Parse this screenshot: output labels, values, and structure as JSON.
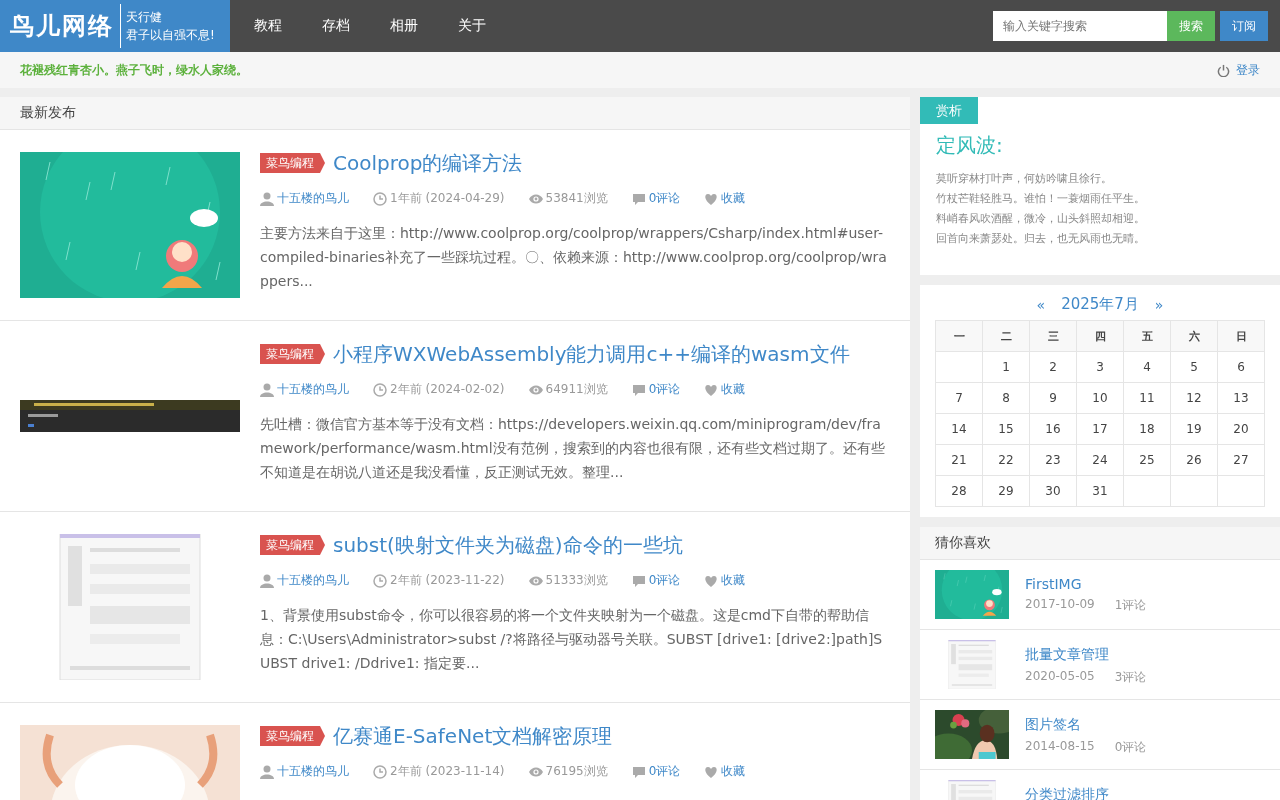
{
  "header": {
    "logo": "鸟儿网络",
    "tagline": [
      "天行健",
      "君子以自强不息!"
    ],
    "nav": [
      {
        "label": "教程"
      },
      {
        "label": "存档"
      },
      {
        "label": "相册"
      },
      {
        "label": "关于"
      }
    ],
    "search": {
      "placeholder": "输入关键字搜索",
      "button": "搜索"
    },
    "subscribe": "订阅"
  },
  "subheader": {
    "motto": "花褪残红青杏小。燕子飞时，绿水人家绕。",
    "login": "登录"
  },
  "latest": {
    "title": "最新发布",
    "articles": [
      {
        "category": "菜鸟编程",
        "title": "Coolprop的编译方法",
        "author": "十五楼的鸟儿",
        "time": "1年前 (2024-04-29)",
        "views": "53841浏览",
        "comments": "0评论",
        "favorite": "收藏",
        "excerpt": "主要方法来自于这里：http://www.coolprop.org/coolprop/wrappers/Csharp/index.html#user-compiled-binaries补充了一些踩坑过程。〇、依赖来源：http://www.coolprop.org/coolprop/wrappers..."
      },
      {
        "category": "菜鸟编程",
        "title": "小程序WXWebAssembly能力调用c++编译的wasm文件",
        "author": "十五楼的鸟儿",
        "time": "2年前 (2024-02-02)",
        "views": "64911浏览",
        "comments": "0评论",
        "favorite": "收藏",
        "excerpt": "先吐槽：微信官方基本等于没有文档：https://developers.weixin.qq.com/miniprogram/dev/framework/performance/wasm.html没有范例，搜索到的内容也很有限，还有些文档过期了。还有些不知道是在胡说八道还是我没看懂，反正测试无效。整理..."
      },
      {
        "category": "菜鸟编程",
        "title": "subst(映射文件夹为磁盘)命令的一些坑",
        "author": "十五楼的鸟儿",
        "time": "2年前 (2023-11-22)",
        "views": "51333浏览",
        "comments": "0评论",
        "favorite": "收藏",
        "excerpt": "1、背景使用subst命令，你可以很容易的将一个文件夹映射为一个磁盘。这是cmd下自带的帮助信息：C:\\Users\\Administrator>subst /?将路径与驱动器号关联。SUBST [drive1: [drive2:]path]SUBST drive1: /Ddrive1: 指定要..."
      },
      {
        "category": "菜鸟编程",
        "title": "亿赛通E-SafeNet文档解密原理",
        "author": "十五楼的鸟儿",
        "time": "2年前 (2023-11-14)",
        "views": "76195浏览",
        "comments": "0评论",
        "favorite": "收藏"
      }
    ]
  },
  "appreciation": {
    "tab": "赏析",
    "title": "定风波:",
    "lines": [
      "莫听穿林打叶声，何妨吟啸且徐行。",
      "竹杖芒鞋轻胜马。谁怕！一蓑烟雨任平生。",
      "料峭春风吹酒醒，微冷，山头斜照却相迎。",
      "回首向来萧瑟处。归去，也无风雨也无晴。"
    ]
  },
  "calendar": {
    "prev": "«",
    "month": "2025年7月",
    "next": "»",
    "weekdays": [
      "一",
      "二",
      "三",
      "四",
      "五",
      "六",
      "日"
    ],
    "weeks": [
      [
        "1",
        "2",
        "3",
        "4",
        "5",
        "6"
      ],
      [
        "7",
        "8",
        "9",
        "10",
        "11",
        "12",
        "13"
      ],
      [
        "14",
        "15",
        "16",
        "17",
        "18",
        "19",
        "20"
      ],
      [
        "21",
        "22",
        "23",
        "24",
        "25",
        "26",
        "27"
      ],
      [
        "28",
        "29",
        "30",
        "31"
      ]
    ]
  },
  "recommend": {
    "title": "猜你喜欢",
    "items": [
      {
        "title": "FirstIMG",
        "date": "2017-10-09",
        "comments": "1评论"
      },
      {
        "title": "批量文章管理",
        "date": "2020-05-05",
        "comments": "3评论"
      },
      {
        "title": "图片签名",
        "date": "2014-08-15",
        "comments": "0评论"
      },
      {
        "title": "分类过滤排序"
      }
    ]
  }
}
